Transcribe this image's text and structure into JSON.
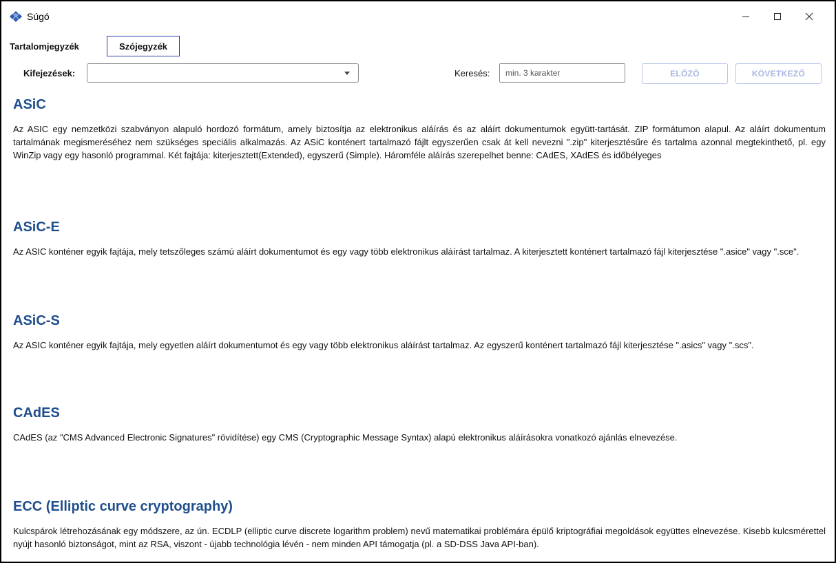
{
  "window": {
    "title": "Súgó",
    "icon": "app-logo-icon",
    "controls": [
      "minimize-icon",
      "maximize-icon",
      "close-icon"
    ]
  },
  "tabs": [
    {
      "label": "Tartalomjegyzék",
      "selected": false
    },
    {
      "label": "Szójegyzék",
      "selected": true
    }
  ],
  "toolbar": {
    "expressions_label": "Kifejezések:",
    "expressions_value": "",
    "search_label": "Keresés:",
    "search_placeholder": "min. 3 karakter",
    "search_value": "",
    "prev_label": "ELŐZŐ",
    "next_label": "KÖVETKEZŐ"
  },
  "entries": [
    {
      "term": "ASiC",
      "definition": "Az ASIC egy nemzetközi szabványon alapuló hordozó formátum, amely biztosítja az elektronikus aláírás és az aláírt dokumentumok együtt-tartását. ZIP formátumon alapul. Az aláírt dokumentum tartalmának megismeréséhez nem szükséges speciális alkalmazás. Az ASiC konténert tartalmazó fájlt egyszerűen csak át kell nevezni \".zip\" kiterjesztésűre és tartalma azonnal megtekinthető, pl. egy WinZip vagy egy hasonló programmal. Két fajtája: kiterjesztett(Extended), egyszerű (Simple). Háromféle aláírás szerepelhet benne: CAdES, XAdES és időbélyeges"
    },
    {
      "term": "ASiC-E",
      "definition": "Az ASIC konténer egyik fajtája, mely tetszőleges számú aláírt dokumentumot és egy vagy több elektronikus aláírást tartalmaz. A kiterjesztett konténert tartalmazó fájl kiterjesztése \".asice\" vagy \".sce\"."
    },
    {
      "term": "ASiC-S",
      "definition": "Az ASIC konténer egyik fajtája, mely egyetlen aláírt dokumentumot és egy vagy több elektronikus aláírást tartalmaz. Az egyszerű konténert tartalmazó fájl kiterjesztése \".asics\" vagy \".scs\"."
    },
    {
      "term": "CAdES",
      "definition": "CAdES (az \"CMS Advanced Electronic Signatures\" rövidítése) egy CMS (Cryptographic Message Syntax) alapú elektronikus aláírásokra vonatkozó ajánlás elnevezése."
    },
    {
      "term": "ECC (Elliptic curve cryptography)",
      "definition": "Kulcspárok létrehozásának egy módszere, az ún. ECDLP (elliptic curve discrete logarithm problem) nevű matematikai problémára épülő kriptográfiai megoldások együttes elnevezése. Kisebb kulcsmérettel nyújt hasonló biztonságot, mint az RSA, viszont - újabb technológia lévén - nem minden API támogatja (pl. a SD-DSS Java API-ban)."
    }
  ],
  "colors": {
    "heading": "#1f4e8c",
    "selected_tab_border": "#2a3aa8",
    "disabled_button_text": "#a9b7e2",
    "disabled_button_border": "#b9c6ea",
    "logo": "#2f5fb3"
  }
}
